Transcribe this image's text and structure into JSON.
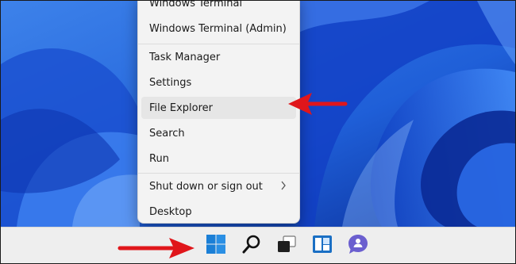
{
  "context_menu": {
    "items": [
      {
        "label": "Windows Terminal"
      },
      {
        "label": "Windows Terminal (Admin)"
      },
      {
        "label": "Task Manager"
      },
      {
        "label": "Settings"
      },
      {
        "label": "File Explorer",
        "highlighted": true
      },
      {
        "label": "Search"
      },
      {
        "label": "Run"
      },
      {
        "label": "Shut down or sign out",
        "has_submenu": true,
        "submenu_icon": "chevron-right"
      },
      {
        "label": "Desktop"
      }
    ]
  },
  "taskbar": {
    "icons": [
      "windows-start-icon",
      "search-icon",
      "task-view-icon",
      "widgets-icon",
      "teams-chat-icon"
    ]
  },
  "colors": {
    "annotation_arrow": "#e0161b",
    "windows_blue": "#1b7fd6",
    "teams_purple": "#6b5fcf"
  }
}
